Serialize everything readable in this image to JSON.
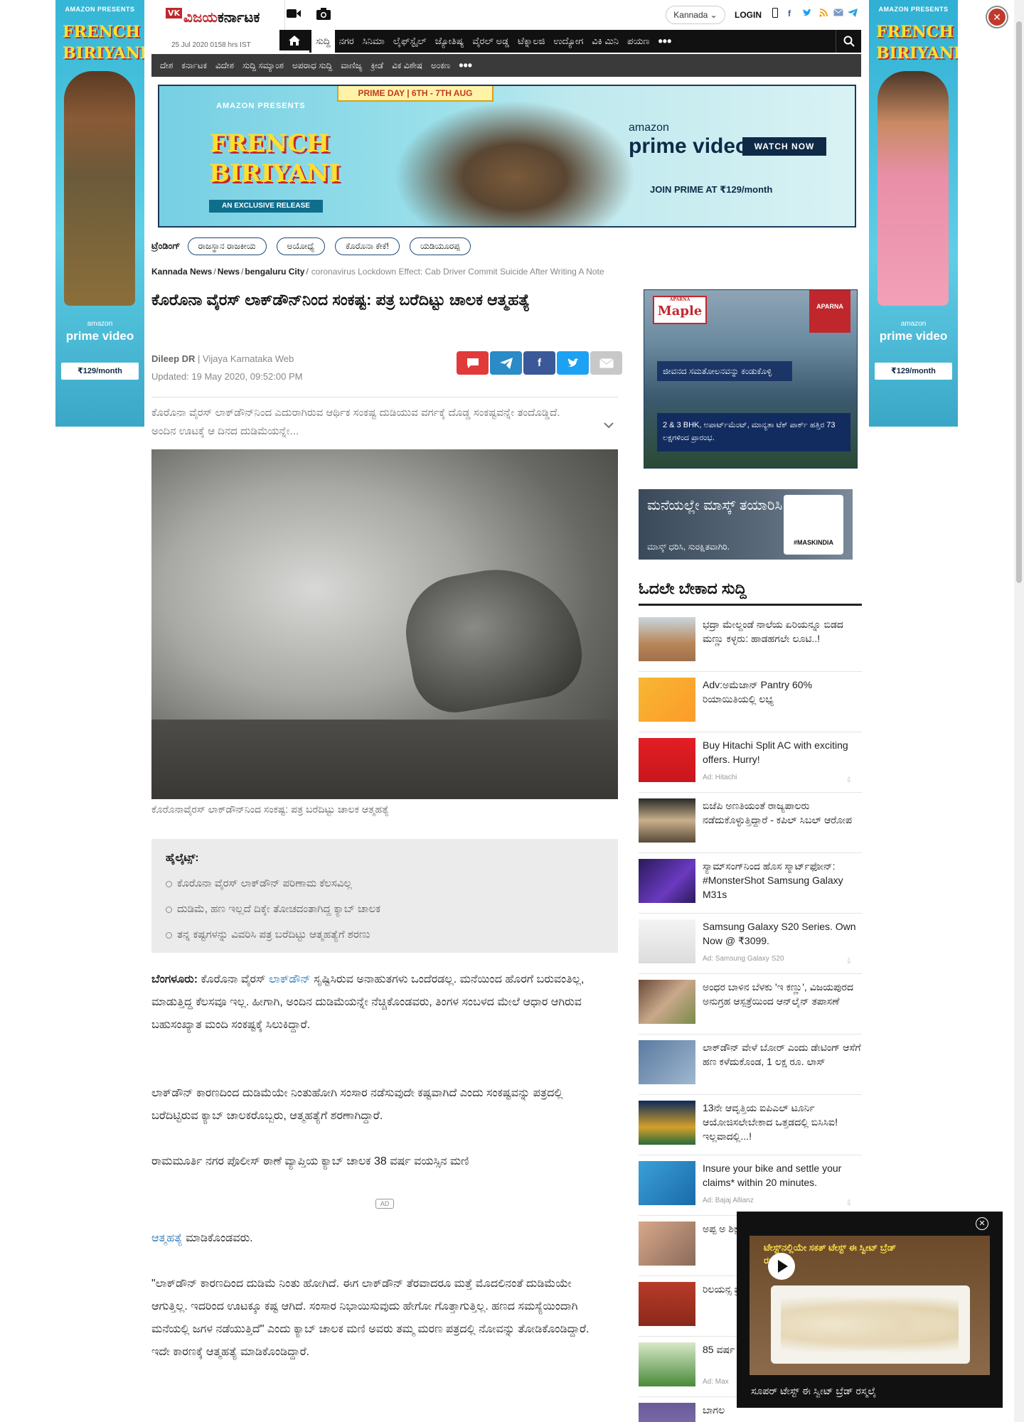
{
  "skin_ads": {
    "left": {
      "presents": "AMAZON PRESENTS",
      "title": "FRENCH BIRIYANI",
      "brand": "amazon",
      "service": "prime video",
      "price": "₹129/month"
    },
    "right": {
      "presents": "AMAZON PRESENTS",
      "title": "FRENCH BIRIYANI",
      "brand": "amazon",
      "service": "prime video",
      "price": "₹129/month"
    }
  },
  "header": {
    "logo_vk": "VK",
    "logo_red": "ವಿಜಯ",
    "logo_black": "ಕರ್ನಾಟಕ",
    "date": "25 Jul 2020 0158 hrs IST",
    "language": "Kannada",
    "login": "LOGIN"
  },
  "nav_primary": [
    "ಸುದ್ದಿ",
    "ನಗರ",
    "ಸಿನಿಮಾ",
    "ಲೈಫ್‌ಸ್ಟೈಲ್",
    "ಜ್ಯೋತಿಷ್ಯ",
    "ವೈರಲ್ ಅಡ್ಡ",
    "ಟೆಕ್ನಾಲಜಿ",
    "ಉದ್ಯೋಗ",
    "ವಿಕಿ ಮಿನಿ",
    "ಪಯಣ"
  ],
  "nav_secondary": [
    "ದೇಶ",
    "ಕರ್ನಾಟಕ",
    "ವಿದೇಶ",
    "ಸುದ್ದಿ ಸಮ್ಯಾಂಶ",
    "ಅಪರಾಧ ಸುದ್ದಿ",
    "ವಾಣಿಜ್ಯ",
    "ಕ್ರೀಡೆ",
    "ವಿಕ ವಿಶೇಷ",
    "ಅಂಕಣ"
  ],
  "banner_ad": {
    "prime_day": "PRIME DAY | 6TH - 7TH AUG",
    "presents": "AMAZON PRESENTS",
    "title": "FRENCH BIRIYANI",
    "exclusive": "AN EXCLUSIVE RELEASE",
    "brand": "amazon",
    "service": "prime video",
    "cta": "WATCH NOW",
    "join": "JOIN PRIME AT ₹129/month"
  },
  "trending": {
    "label": "ಟ್ರೆಂಡಿಂಗ್",
    "items": [
      "ರಾಜಸ್ಥಾನ ರಾಜಕೀಯ",
      "ಅಯೋಧ್ಯೆ",
      "ಕೊರೊನಾ ಕೇಕೆ!",
      "ಯಡಿಯೂರಪ್ಪ"
    ]
  },
  "breadcrumb": {
    "items": [
      "Kannada News",
      "News",
      "bengaluru City"
    ],
    "current": "coronavirus Lockdown Effect: Cab Driver Commit Suicide After Writing A Note"
  },
  "article": {
    "title": "ಕೊರೊನಾ ವೈರಸ್ ಲಾಕ್‌ಡೌನ್‌ನಿಂದ ಸಂಕಷ್ಟ: ಪತ್ರ ಬರೆದಿಟ್ಟು ಚಾಲಕ ಆತ್ಮಹತ್ಯೆ",
    "author": "Dileep DR",
    "publication": "Vijaya Karnataka Web",
    "updated": "Updated: 19 May 2020, 09:52:00 PM",
    "summary": "ಕೊರೊನಾ ವೈರಸ್ ಲಾಕ್‌ಡೌನ್‌ನಿಂದ ಎದುರಾಗಿರುವ ಆರ್ಥಿಕ ಸಂಕಷ್ಟ ದುಡಿಯುವ ವರ್ಗಕ್ಕೆ ದೊಡ್ಡ ಸಂಕಷ್ಟವನ್ನೇ ತಂದೊಡ್ಡಿದೆ. ಅಂದಿನ ಊಟಕ್ಕೆ ಆ ದಿನದ ದುಡಿಮೆಯನ್ನೇ...",
    "caption": "ಕೊರೊನಾವೈರಸ್ ಲಾಕ್‌ಡೌನ್‌ನಿಂದ ಸಂಕಷ್ಟ: ಪತ್ರ ಬರೆದಿಟ್ಟು ಚಾಲಕ ಆತ್ಮಹತ್ಯೆ",
    "highlights_title": "ಹೈಲೈಟ್ಸ್:",
    "highlights": [
      "ಕೊರೊನಾ ವೈರಸ್ ಲಾಕ್‌ಡೌನ್ ಪರಿಣಾಮ ಕೆಲಸವಿಲ್ಲ",
      "ದುಡಿಮೆ, ಹಣ ಇಲ್ಲದೆ ದಿಕ್ಕೇ ತೋಚದಂತಾಗಿದ್ದ ಕ್ಯಾಬ್ ಚಾಲಕ",
      "ತನ್ನ ಕಷ್ಟಗಳನ್ನು ವಿವರಿಸಿ ಪತ್ರ ಬರೆದಿಟ್ಟು ಆತ್ಮಹತ್ಯೆಗೆ ಶರಣು"
    ],
    "p1_lead": "ಬೆಂಗಳೂರು:",
    "p1_a": " ಕೊರೊನಾ ವೈರಸ್ ",
    "p1_link": "ಲಾಕ್‌ಡೌನ್",
    "p1_b": " ಸೃಷ್ಟಿಸಿರುವ ಅನಾಹುತಗಳು ಒಂದೆರಡಲ್ಲ. ಮನೆಯಿಂದ ಹೊರಗೆ ಬರುವಂತಿಲ್ಲ, ಮಾಡುತ್ತಿದ್ದ ಕೆಲಸವೂ ಇಲ್ಲ. ಹೀಗಾಗಿ, ಅಂದಿನ ದುಡಿಮೆಯನ್ನೇ ನೆಚ್ಚಿಕೊಂಡವರು, ತಿಂಗಳ ಸಂಬಳದ ಮೇಲೆ ಆಧಾರ ಆಗಿರುವ ಬಹುಸಂಖ್ಯಾತ ಮಂದಿ ಸಂಕಷ್ಟಕ್ಕೆ ಸಿಲುಕಿದ್ದಾರೆ.",
    "p2": "ಲಾಕ್‌ಡೌನ್ ಕಾರಣದಿಂದ ದುಡಿಮೆಯೇ ನಿಂತುಹೋಗಿ ಸಂಸಾರ ನಡೆಸುವುದೇ ಕಷ್ಟವಾಗಿದೆ ಎಂದು ಸಂಕಷ್ಟವನ್ನು ಪತ್ರದಲ್ಲಿ ಬರೆದಿಟ್ಟಿರುವ ಕ್ಯಾಬ್ ಚಾಲಕರೊಬ್ಬರು, ಆತ್ಮಹತ್ಯೆಗೆ ಶರಣಾಗಿದ್ದಾರೆ.",
    "p3": "ರಾಮಮೂರ್ತಿ ನಗರ ಪೊಲೀಸ್ ಠಾಣೆ ವ್ಯಾಪ್ತಿಯ ಕ್ಯಾಬ್ ಚಾಲಕ 38 ವರ್ಷ ವಯಸ್ಸಿನ ಮಣಿ",
    "ad_label": "AD",
    "p4_link": "ಆತ್ಮಹತ್ಯೆ",
    "p4": " ಮಾಡಿಕೊಂಡವರು.",
    "p5": "\"ಲಾಕ್‌ಡೌನ್ ಕಾರಣದಿಂದ ದುಡಿಮೆ ನಿಂತು ಹೋಗಿದೆ. ಈಗ ಲಾಕ್‌ಡೌನ್ ತೆರವಾದರೂ ಮತ್ತೆ ಮೊದಲಿನಂತೆ ದುಡಿಮೆಯೇ ಆಗುತ್ತಿಲ್ಲ. ಇದರಿಂದ ಊಟಕ್ಕೂ ಕಷ್ಟ ಆಗಿದೆ. ಸಂಸಾರ ನಿಭಾಯಿಸುವುದು ಹೇಗೋ ಗೊತ್ತಾಗುತ್ತಿಲ್ಲ. ಹಣದ ಸಮಸ್ಯೆಯಿಂದಾಗಿ ಮನೆಯಲ್ಲಿ ಜಗಳ ನಡೆಯುತ್ತಿದೆ\" ಎಂದು ಕ್ಯಾಬ್ ಚಾಲಕ ಮಣಿ ಅವರು ತಮ್ಮ ಮರಣ ಪತ್ರದಲ್ಲಿ ನೋವನ್ನು ತೋಡಿಕೊಂಡಿದ್ದಾರೆ. ಇದೇ ಕಾರಣಕ್ಕೆ ಆತ್ಮಹತ್ಯೆ ಮಾಡಿಕೊಂಡಿದ್ದಾರೆ."
  },
  "right_ads": {
    "aparna": {
      "brand": "Maple",
      "brand_small": "APARNA",
      "maker": "APARNA",
      "line1": "ಜೀವನದ ಸಮತೋಲನವನ್ನು ಕಂಡುಕೊಳ್ಳಿ",
      "line2": "2 & 3 BHK, ಅಪಾರ್ಟ್‌ಮೆಂಟ್, ಮಾನ್ಯತಾ ಟೆಕ್ ಪಾರ್ಕ್ ಹತ್ತಿರ 73 ಲಕ್ಷಗಳಿಂದ ಪ್ರಾರಂಭ."
    },
    "mask": {
      "line1": "ಮನೆಯಲ್ಲೇ ಮಾಸ್ಕ್ ತಯಾರಿಸಿ",
      "line2": "ಮಾಸ್ಕ್ ಧರಿಸಿ, ಸುರಕ್ಷಿತವಾಗಿರಿ.",
      "tag": "#MASKINDIA"
    }
  },
  "must_read": {
    "title": "ಓದಲೇ ಬೇಕಾದ ಸುದ್ದಿ",
    "items": [
      {
        "text": "ಭದ್ರಾ ಮೇಲ್ದಂಡೆ ನಾಲೆಯ ಏರಿಯನ್ನೂ ಬಿಡದ ಮಣ್ಣು ಕಳ್ಳರು: ಹಾಡಹಗಲೇ ಲೂಟಿ..!",
        "sponsor": ""
      },
      {
        "text": "Adv:ಅಮೆಜಾನ್ Pantry 60% ರಿಯಾಯಿತಿಯಲ್ಲಿ ಲಭ್ಯ",
        "sponsor": ""
      },
      {
        "text": "Buy Hitachi Split AC with exciting offers. Hurry!",
        "sponsor": "Ad: Hitachi"
      },
      {
        "text": "ಬಿಜೆಪಿ ಅಣತಿಯಂತೆ ರಾಜ್ಯಪಾಲರು ನಡೆದುಕೊಳ್ಳುತ್ತಿದ್ದಾರೆ - ಕಪಿಲ್ ಸಿಬಲ್ ಆರೋಪ",
        "sponsor": ""
      },
      {
        "text": "ಸ್ಯಾಮ್‌ಸಂಗ್‌ನಿಂದ ಹೊಸ ಸ್ಮಾರ್ಟ್‌ಫೋನ್: #MonsterShot Samsung Galaxy M31s",
        "sponsor": ""
      },
      {
        "text": "Samsung Galaxy S20 Series. Own Now @ ₹3099.",
        "sponsor": "Ad: Samsung Galaxy S20"
      },
      {
        "text": "ಅಂಧರ ಬಾಳಿನ ಬೆಳಕು 'ಇ ಕಣ್ಣು', ವಿಜಯಪುರದ ಅನುಗ್ರಹ ಆಸ್ಪತ್ರೆಯಿಂದ ಆನ್‌ಲೈನ್ ತಪಾಸಣೆ",
        "sponsor": ""
      },
      {
        "text": "ಲಾಕ್‌ಡೌನ್ ವೇಳೆ ಬೋರ್ ಎಂದು ಡೇಟಿಂಗ್ ಆಸೆಗೆ ಹಣ ಕಳೆದುಕೊಂಡ, 1 ಲಕ್ಷ ರೂ. ಲಾಸ್",
        "sponsor": ""
      },
      {
        "text": "13ನೇ ಆವೃತ್ತಿಯ ಐಪಿಎಲ್ ಟೂರ್ನಿ ಆಯೋಜಿಸಲೇಬೇಕಾದ ಒತ್ತಡದಲ್ಲಿ ಬಿಸಿಸಿಐ! ಇಲ್ಲವಾದಲ್ಲಿ...!",
        "sponsor": ""
      },
      {
        "text": "Insure your bike and settle your claims* within 20 minutes.",
        "sponsor": "Ad: Bajaj Allianz"
      },
      {
        "text": "ಅಪ್ಪ ಅ ಶಿಕ್ಷಣ ಹಸುವ",
        "sponsor": ""
      },
      {
        "text": "ರಿಲಯನ್ಸ ಪ್ರಯತ್ನ",
        "sponsor": ""
      },
      {
        "text": "85 ವರ್ಷ ಮಳೆಪಾ",
        "sponsor": "Ad: Max"
      },
      {
        "text": "ಬಾಗಲ",
        "sponsor": ""
      }
    ]
  },
  "video_player": {
    "overlay_title": "ಟೇಸ್ಟ್‌ನಲ್ಲಿಯೇ ಸಕತ್ ಟೇಸ್ಟ್ ಈ ಸ್ವೀಟ್ ಬ್ರೆಡ್ ರಸ್ಮಲೈ",
    "caption": "ಸೂಪರ್ ಟೇಸ್ಟ್ ಈ ಸ್ವೀಟ್ ಬ್ರೆಡ್ ರಸ್ಮಲೈ"
  },
  "colors": {
    "brand_red": "#c0272d",
    "nav_black": "#111111",
    "nav_grey": "#3a3a3a",
    "link_blue": "#1f6fb2"
  }
}
